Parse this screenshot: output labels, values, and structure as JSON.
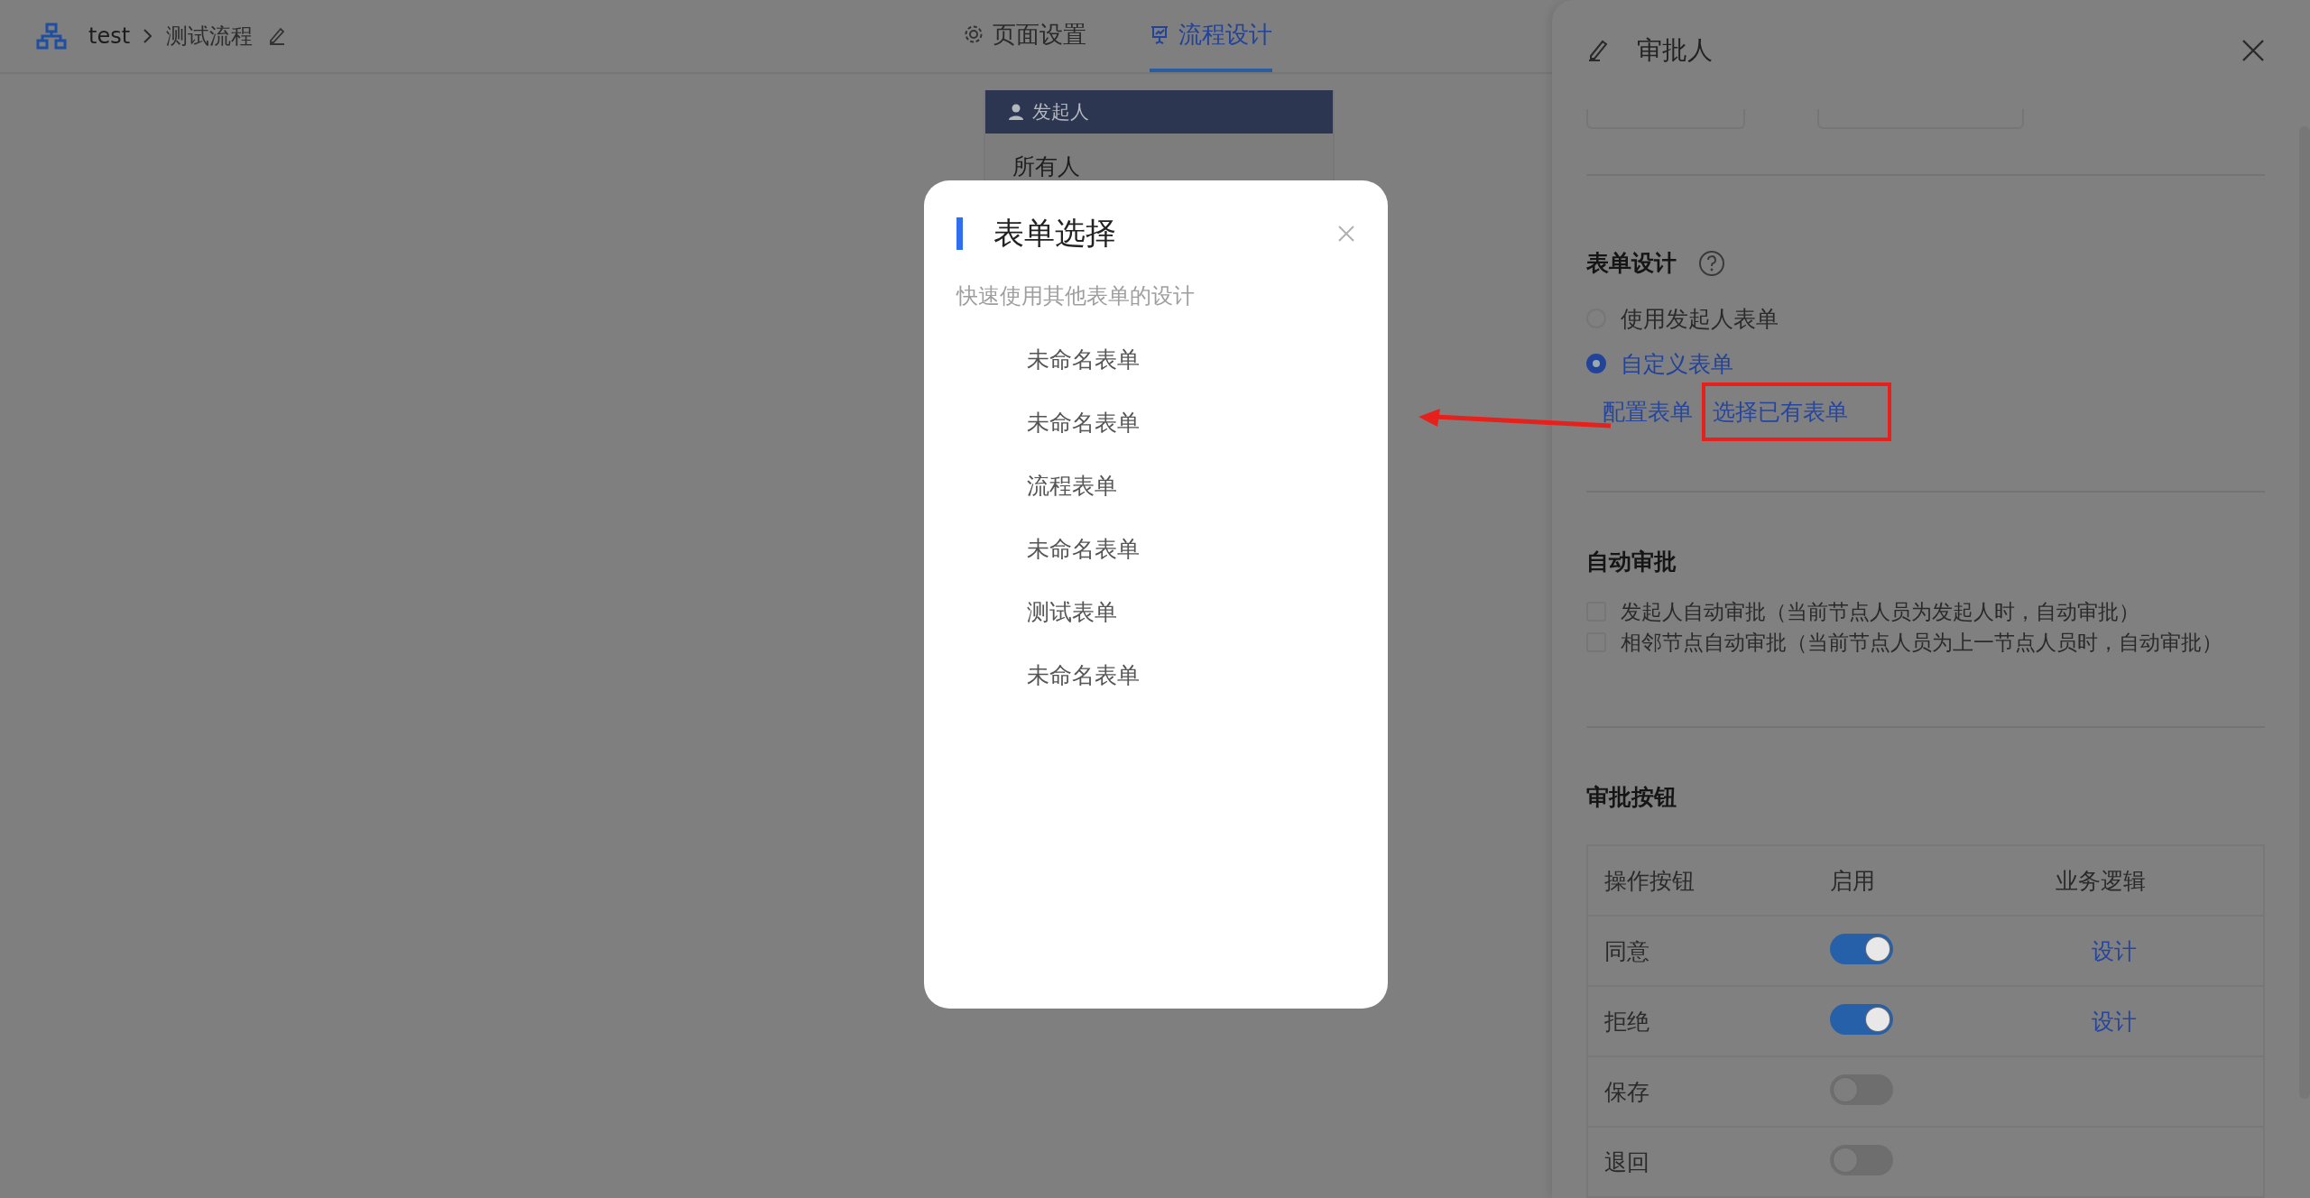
{
  "breadcrumb": {
    "root": "test",
    "current": "测试流程"
  },
  "tabs": [
    {
      "label": "页面设置",
      "selected": false
    },
    {
      "label": "流程设计",
      "selected": true
    }
  ],
  "flow_node": {
    "title": "发起人",
    "content": "所有人"
  },
  "modal": {
    "title": "表单选择",
    "subtitle": "快速使用其他表单的设计",
    "items": [
      "未命名表单",
      "未命名表单",
      "流程表单",
      "未命名表单",
      "测试表单",
      "未命名表单"
    ]
  },
  "panel": {
    "title": "审批人",
    "form_design": {
      "heading": "表单设计",
      "options": [
        {
          "label": "使用发起人表单",
          "selected": false
        },
        {
          "label": "自定义表单",
          "selected": true
        }
      ],
      "links": [
        {
          "label": "配置表单",
          "highlighted": false
        },
        {
          "label": "选择已有表单",
          "highlighted": true
        }
      ]
    },
    "auto_approve": {
      "heading": "自动审批",
      "options": [
        {
          "label": "发起人自动审批（当前节点人员为发起人时，自动审批）",
          "checked": false
        },
        {
          "label": "相邻节点自动审批（当前节点人员为上一节点人员时，自动审批）",
          "checked": false
        }
      ]
    },
    "buttons_section": {
      "heading": "审批按钮",
      "columns": [
        "操作按钮",
        "启用",
        "业务逻辑"
      ],
      "rows": [
        {
          "name": "同意",
          "on": true,
          "logic": "设计"
        },
        {
          "name": "拒绝",
          "on": true,
          "logic": "设计"
        },
        {
          "name": "保存",
          "on": false
        },
        {
          "name": "退回",
          "on": false
        }
      ]
    }
  }
}
